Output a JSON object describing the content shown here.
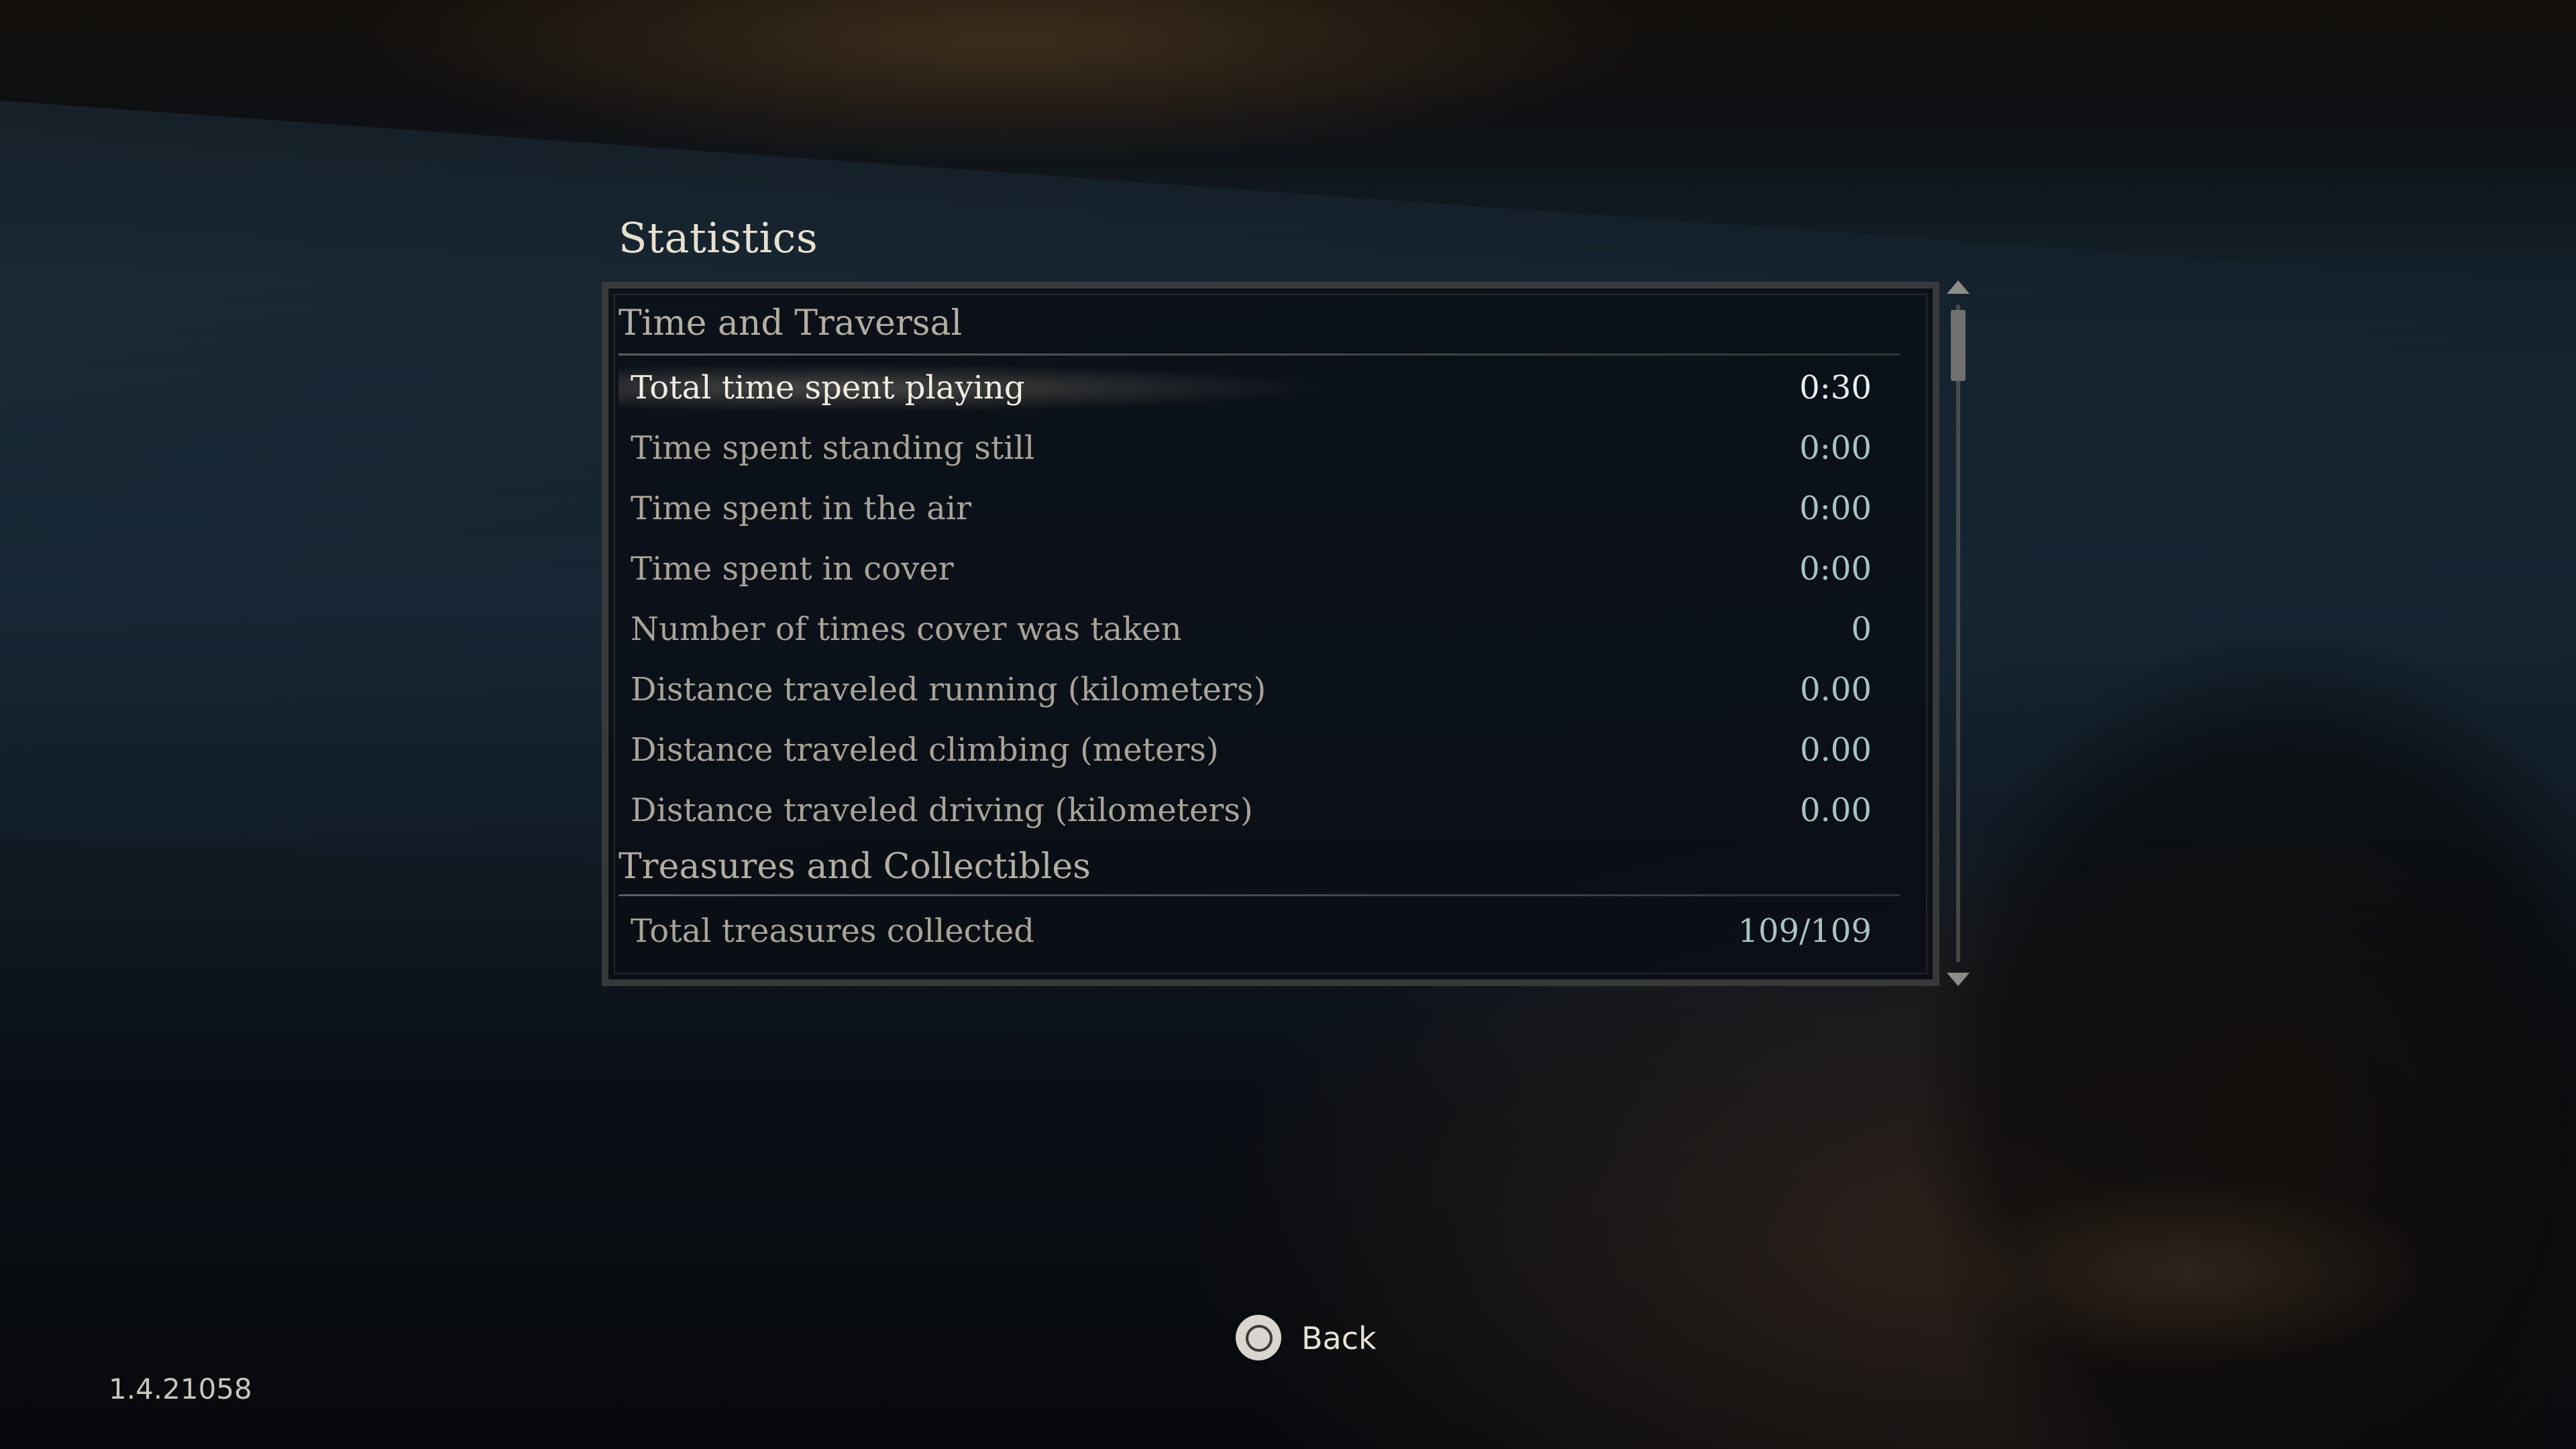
{
  "screen": {
    "title": "Statistics",
    "version": "1.4.21058"
  },
  "sections": [
    {
      "label": "Time and Traversal",
      "rows": [
        {
          "label": "Total time spent playing",
          "value": "0:30"
        },
        {
          "label": "Time spent standing still",
          "value": "0:00"
        },
        {
          "label": "Time spent in the air",
          "value": "0:00"
        },
        {
          "label": "Time spent in cover",
          "value": "0:00"
        },
        {
          "label": "Number of times cover was taken",
          "value": "0"
        },
        {
          "label": "Distance traveled running (kilometers)",
          "value": "0.00"
        },
        {
          "label": "Distance traveled climbing (meters)",
          "value": "0.00"
        },
        {
          "label": "Distance traveled driving (kilometers)",
          "value": "0.00"
        }
      ]
    },
    {
      "label": "Treasures and Collectibles",
      "rows": [
        {
          "label": "Total treasures collected",
          "value": "109/109"
        }
      ]
    }
  ],
  "selected_row": "Total time spent playing",
  "scroll": {
    "position_fraction": 0.0,
    "visible_fraction": 0.11
  },
  "footer": {
    "back_button_icon": "circle-button-icon",
    "back_label": "Back"
  },
  "colors": {
    "selected_text": "#f2ede2",
    "value_text": "#a8c3c6",
    "label_text": "#a9a398"
  }
}
